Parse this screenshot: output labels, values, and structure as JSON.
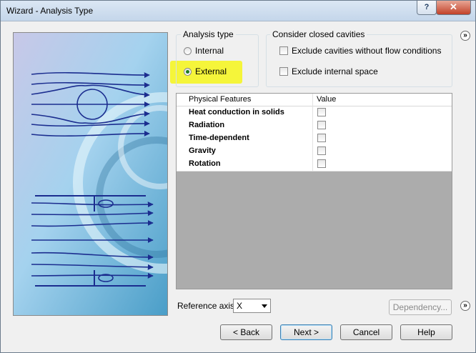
{
  "window": {
    "title": "Wizard - Analysis Type",
    "help_label": "?",
    "close_label": "✕"
  },
  "analysis_type": {
    "label": "Analysis type",
    "options": [
      {
        "label": "Internal",
        "selected": false
      },
      {
        "label": "External",
        "selected": true
      }
    ]
  },
  "closed_cavities": {
    "label": "Consider closed cavities",
    "options": [
      {
        "label": "Exclude cavities without flow conditions",
        "checked": false
      },
      {
        "label": "Exclude internal space",
        "checked": false
      }
    ]
  },
  "physical_features": {
    "headers": {
      "name": "Physical Features",
      "value": "Value"
    },
    "rows": [
      {
        "name": "Heat conduction in solids",
        "checked": false
      },
      {
        "name": "Radiation",
        "checked": false
      },
      {
        "name": "Time-dependent",
        "checked": false
      },
      {
        "name": "Gravity",
        "checked": false
      },
      {
        "name": "Rotation",
        "checked": false
      }
    ]
  },
  "reference_axis": {
    "label": "Reference axis:",
    "value": "X"
  },
  "buttons": {
    "dependency": "Dependency...",
    "back": "< Back",
    "next": "Next >",
    "cancel": "Cancel",
    "help": "Help"
  },
  "expand_icons": {
    "symbol": "»"
  },
  "colors": {
    "highlight": "#f5f53a",
    "flow_lines": "#1b2d8f",
    "radio_selected": "#1f7a1f"
  }
}
